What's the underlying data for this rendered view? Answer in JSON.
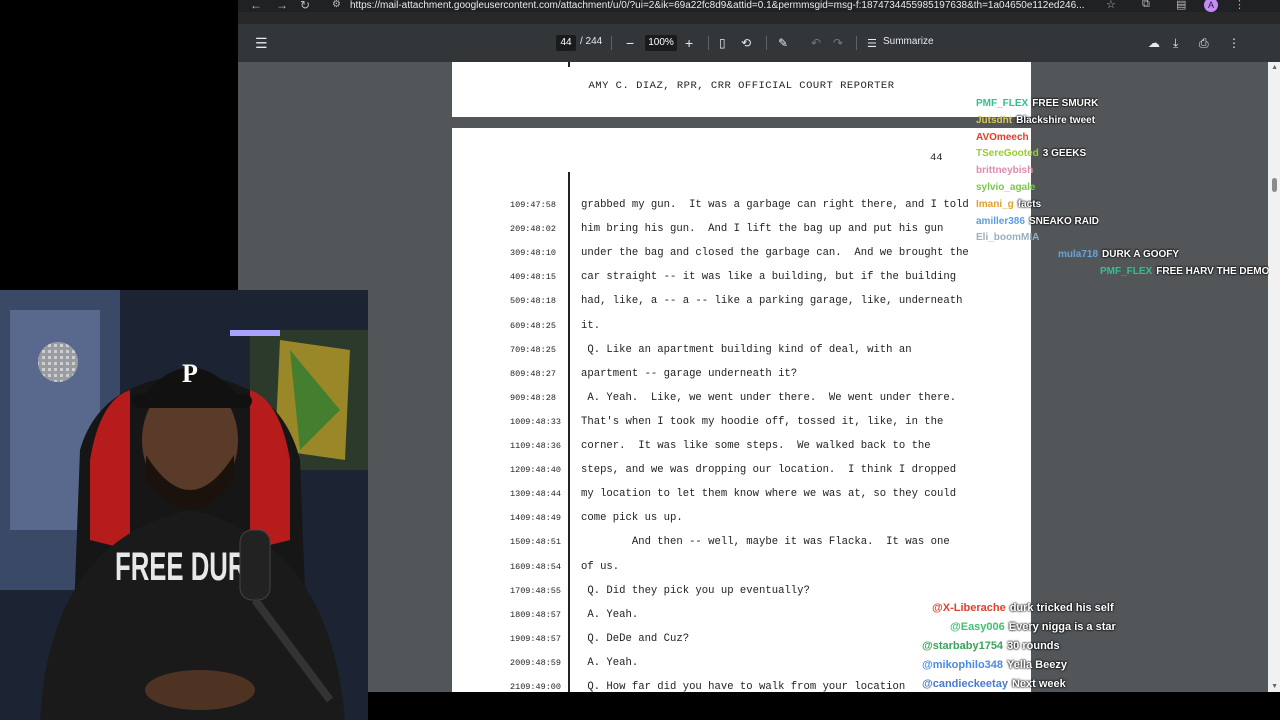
{
  "browser": {
    "url": "https://mail-attachment.googleusercontent.com/attachment/u/0/?ui=2&ik=69a22fc8d9&attid=0.1&permmsgid=msg-f:1874734455985197638&th=1a04650e112ed246...",
    "avatar_letter": "A"
  },
  "pdf_toolbar": {
    "page_current": "44",
    "page_total": "/ 244",
    "zoom": "100%",
    "summarize_label": "Summarize"
  },
  "document": {
    "reporter_line": "AMY C. DIAZ, RPR, CRR OFFICIAL COURT REPORTER",
    "page_number": "44",
    "lines": [
      {
        "num": "1",
        "time": "09:47:58",
        "text": "grabbed my gun.  It was a garbage can right there, and I told"
      },
      {
        "num": "2",
        "time": "09:48:02",
        "text": "him bring his gun.  And I lift the bag up and put his gun"
      },
      {
        "num": "3",
        "time": "09:48:10",
        "text": "under the bag and closed the garbage can.  And we brought the"
      },
      {
        "num": "4",
        "time": "09:48:15",
        "text": "car straight -- it was like a building, but if the building"
      },
      {
        "num": "5",
        "time": "09:48:18",
        "text": "had, like, a -- a -- like a parking garage, like, underneath"
      },
      {
        "num": "6",
        "time": "09:48:25",
        "text": "it."
      },
      {
        "num": "7",
        "time": "09:48:25",
        "text": " Q. Like an apartment building kind of deal, with an"
      },
      {
        "num": "8",
        "time": "09:48:27",
        "text": "apartment -- garage underneath it?"
      },
      {
        "num": "9",
        "time": "09:48:28",
        "text": " A. Yeah.  Like, we went under there.  We went under there."
      },
      {
        "num": "10",
        "time": "09:48:33",
        "text": "That's when I took my hoodie off, tossed it, like, in the"
      },
      {
        "num": "11",
        "time": "09:48:36",
        "text": "corner.  It was like some steps.  We walked back to the"
      },
      {
        "num": "12",
        "time": "09:48:40",
        "text": "steps, and we was dropping our location.  I think I dropped"
      },
      {
        "num": "13",
        "time": "09:48:44",
        "text": "my location to let them know where we was at, so they could"
      },
      {
        "num": "14",
        "time": "09:48:49",
        "text": "come pick us up."
      },
      {
        "num": "15",
        "time": "09:48:51",
        "text": "        And then -- well, maybe it was Flacka.  It was one"
      },
      {
        "num": "16",
        "time": "09:48:54",
        "text": "of us."
      },
      {
        "num": "17",
        "time": "09:48:55",
        "text": " Q. Did they pick you up eventually?"
      },
      {
        "num": "18",
        "time": "09:48:57",
        "text": " A. Yeah."
      },
      {
        "num": "19",
        "time": "09:48:57",
        "text": " Q. DeDe and Cuz?"
      },
      {
        "num": "20",
        "time": "09:48:59",
        "text": " A. Yeah."
      },
      {
        "num": "21",
        "time": "09:49:00",
        "text": " Q. How far did you have to walk from your location"
      }
    ]
  },
  "chat_top": [
    {
      "user": "PMF_FLEX",
      "msg": "FREE SMURK",
      "color": "#2fc28e"
    },
    {
      "user": "Jutsdht",
      "msg": "Blackshire tweet",
      "color": "#d8c85a"
    },
    {
      "user": "AVOmeech",
      "msg": "",
      "color": "#e0402e"
    },
    {
      "user": "TSereGooted",
      "msg": "3 GEEKS",
      "color": "#9acd32"
    },
    {
      "user": "brittneybish",
      "msg": "",
      "color": "#e08ab0"
    },
    {
      "user": "sylvio_agale",
      "msg": "",
      "color": "#7ac943"
    },
    {
      "user": "Imani_g",
      "msg": "facts",
      "color": "#e0a030"
    },
    {
      "user": "amiller386",
      "msg": "SNEAKO RAID",
      "color": "#5a9ee0"
    },
    {
      "user": "Eli_boomMIA",
      "msg": "",
      "color": "#9ab0c0"
    },
    {
      "user": "mula718",
      "msg": "DURK A GOOFY",
      "color": "#6aa3d8"
    },
    {
      "user": "PMF_FLEX",
      "msg": "FREE HARV THE DEMO",
      "color": "#2fc28e"
    }
  ],
  "chat_bottom": [
    {
      "user": "@X-Liberache",
      "msg": "durk tricked his self",
      "color": "#e0402e"
    },
    {
      "user": "@Easy006",
      "msg": "Every nigga is a star",
      "color": "#3ec46e"
    },
    {
      "user": "@starbaby1754",
      "msg": "30 rounds",
      "color": "#3aa35a"
    },
    {
      "user": "@mikophilo348",
      "msg": "Yella Beezy",
      "color": "#4a8ae0"
    },
    {
      "user": "@candieckeetay",
      "msg": "Next week",
      "color": "#4a7ad0"
    }
  ],
  "webcam": {
    "cap_letter": "P",
    "hoodie_text": "FREE DURK"
  }
}
